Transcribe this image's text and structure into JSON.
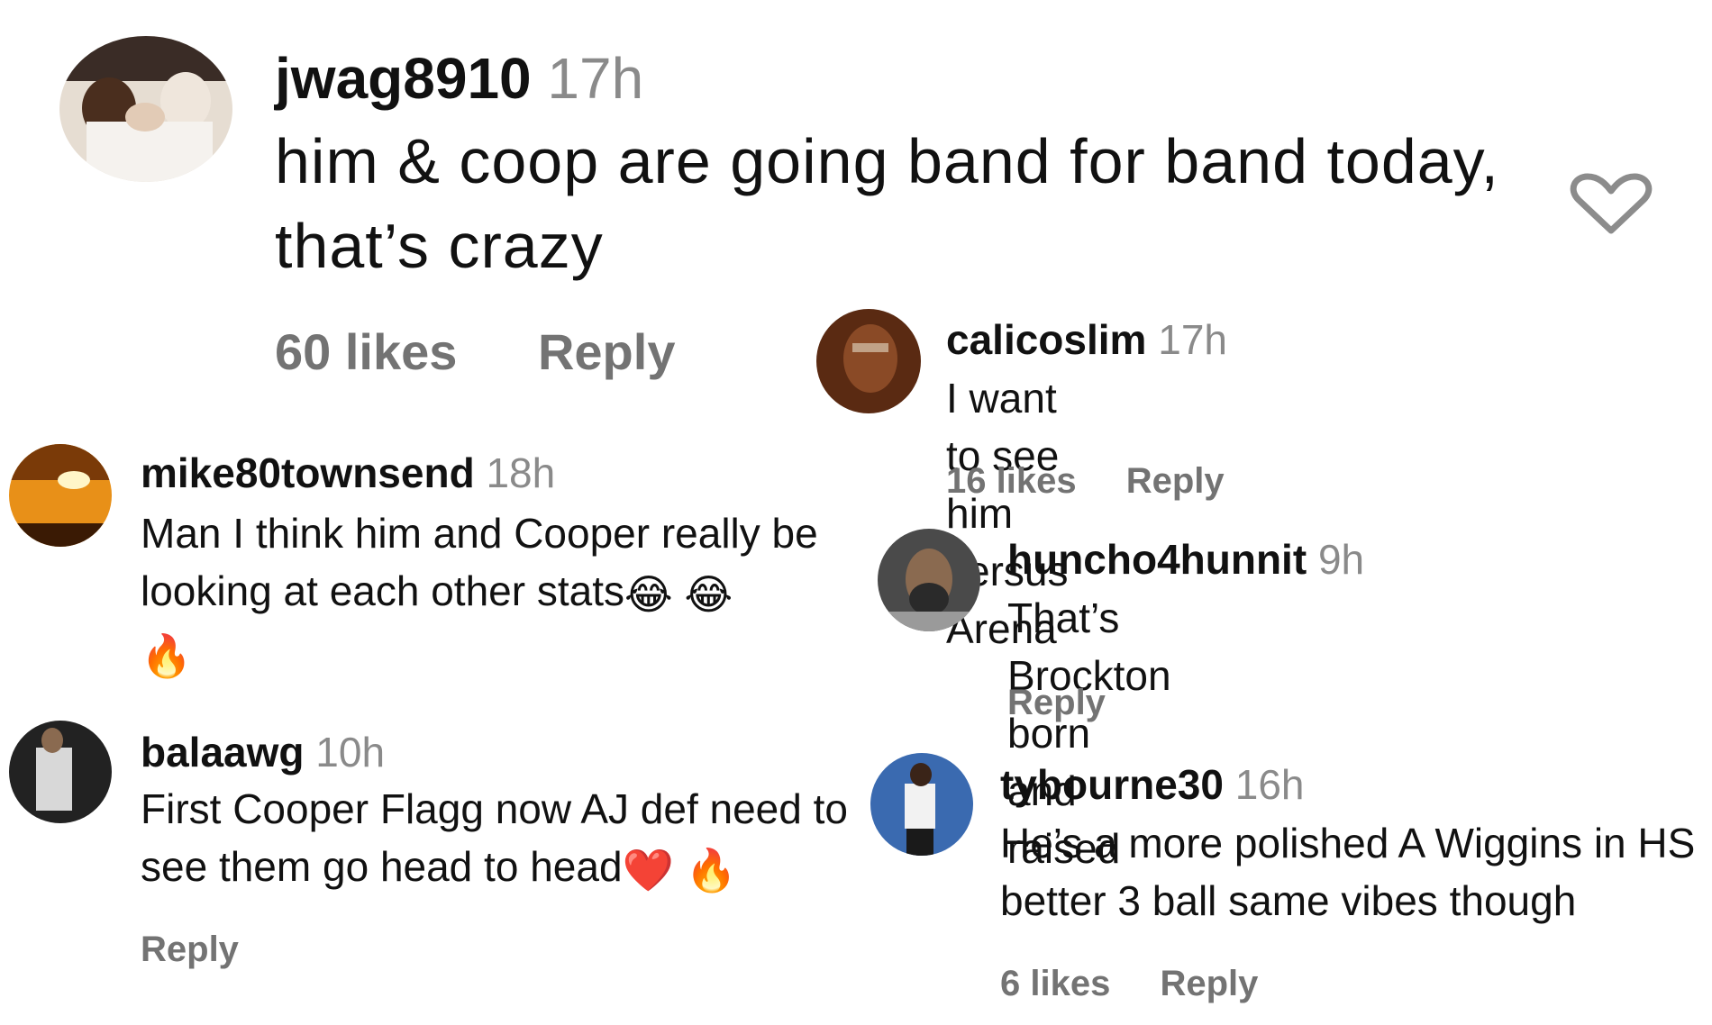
{
  "comments": [
    {
      "id": "jwag8910",
      "username": "jwag8910",
      "time": "17h",
      "text": "him & coop are going band for band today, that’s crazy",
      "likes": "60 likes",
      "reply": "Reply",
      "avatar_colors": [
        "#d9cfc4",
        "#3a2a22",
        "#f1ece6"
      ]
    },
    {
      "id": "calicoslim",
      "username": "calicoslim",
      "time": "17h",
      "text": "I want to see him versus Arena",
      "likes": "16 likes",
      "reply": "Reply",
      "avatar_colors": [
        "#7a3a1c",
        "#3a160a",
        "#c8a07a"
      ]
    },
    {
      "id": "mike80townsend",
      "username": "mike80townsend",
      "time": "18h",
      "text": "Man I think him and Cooper really be looking at each other stats",
      "emojis": [
        "😂",
        "😂",
        "🔥"
      ],
      "reply": "",
      "avatar_colors": [
        "#f0a020",
        "#6b2e05",
        "#fff2b0"
      ]
    },
    {
      "id": "huncho4hunnit",
      "username": "huncho4hunnit",
      "time": "9h",
      "text": "That’s Brockton born and raised",
      "reply": "Reply",
      "avatar_colors": [
        "#6a6a6a",
        "#2b2b2b",
        "#b5a08a"
      ]
    },
    {
      "id": "balaawg",
      "username": "balaawg",
      "time": "10h",
      "text": "First Cooper Flagg now AJ def need to see them go head to head",
      "emojis": [
        "❤️",
        "🔥"
      ],
      "reply": "Reply",
      "avatar_colors": [
        "#2a2a2a",
        "#d8d8d8",
        "#8a6a50"
      ]
    },
    {
      "id": "tybourne30",
      "username": "tybourne30",
      "time": "16h",
      "text": "He’s a more polished A Wiggins in HS better 3 ball same vibes though",
      "likes": "6 likes",
      "reply": "Reply",
      "avatar_colors": [
        "#3a6ab0",
        "#f2f2f2",
        "#1c2b44"
      ]
    }
  ],
  "icons": {
    "like": "heart-outline-icon"
  },
  "colors": {
    "text": "#111111",
    "muted": "#737373",
    "time": "#8a8a8a",
    "heart": "#8c8c8c"
  }
}
